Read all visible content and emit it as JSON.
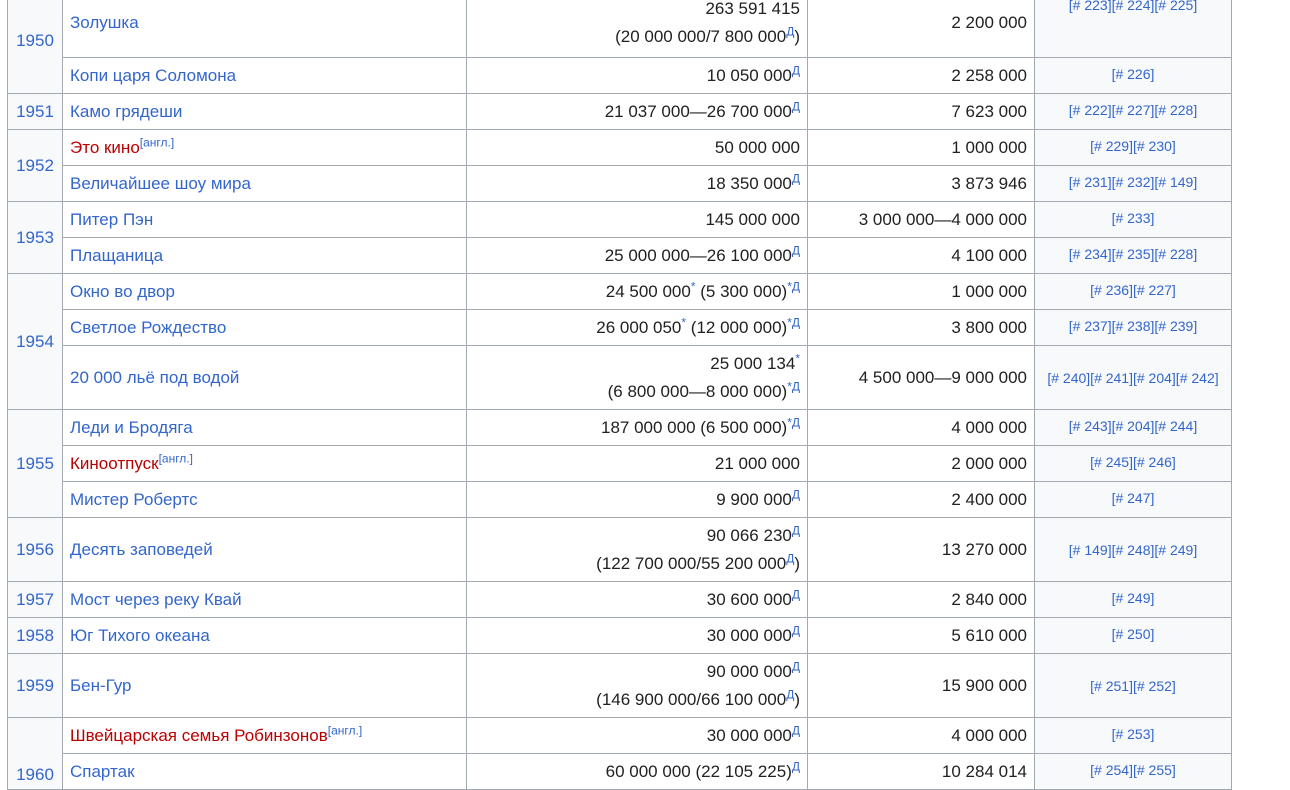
{
  "rows": [
    {
      "year": "1950",
      "title": "Золушка",
      "gross1": "263 591 415",
      "gross2": "(20 000 000/7 800 000",
      "gross2_sup": "Д",
      "gross2_tail": ")",
      "budget": "2 200 000",
      "refs": "[# 223][# 224][# 225]"
    },
    {
      "title": "Копи царя Соломона",
      "gross1": "10 050 000",
      "gross1_sup": "Д",
      "budget": "2 258 000",
      "refs": "[# 226]"
    },
    {
      "year": "1951",
      "title": "Камо грядеши",
      "gross1": "21 037 000—26 700 000",
      "gross1_sup": "Д",
      "budget": "7 623 000",
      "refs": "[# 222][# 227][# 228]"
    },
    {
      "year": "1952",
      "title": "Это кино",
      "title_sup": "[англ.]",
      "gross1": "50 000 000",
      "budget": "1 000 000",
      "refs": "[# 229][# 230]"
    },
    {
      "title": "Величайшее шоу мира",
      "gross1": "18 350 000",
      "gross1_sup": "Д",
      "budget": "3 873 946",
      "refs": "[# 231][# 232][# 149]"
    },
    {
      "year": "1953",
      "title": "Питер Пэн",
      "gross1": "145 000 000",
      "budget": "3 000 000—4 000 000",
      "refs": "[# 233]"
    },
    {
      "title": "Плащаница",
      "gross1": "25 000 000—26 100 000",
      "gross1_sup": "Д",
      "budget": "4 100 000",
      "refs": "[# 234][# 235][# 228]"
    },
    {
      "year": "1954",
      "title": "Окно во двор",
      "gross1": "24 500 000",
      "gross1_star": "*",
      "gross1_b": " (5 300 000)",
      "gross1_sup": "*Д",
      "budget": "1 000 000",
      "refs": "[# 236][# 227]"
    },
    {
      "title": "Светлое Рождество",
      "gross1": "26 000 050",
      "gross1_star": "*",
      "gross1_b": " (12 000 000)",
      "gross1_sup": "*Д",
      "budget": "3 800 000",
      "refs": "[# 237][# 238][# 239]"
    },
    {
      "title": "20 000 льё под водой",
      "gross1": "25 000 134",
      "gross1_star": "*",
      "gross2": "(6 800 000—8 000 000)",
      "gross2_sup": "*Д",
      "budget": "4 500 000—9 000 000",
      "refs": "[# 240][# 241][# 204][# 242]"
    },
    {
      "year": "1955",
      "title": "Леди и Бродяга",
      "gross1": "187 000 000 (6 500 000)",
      "gross1_sup": "*Д",
      "budget": "4 000 000",
      "refs": "[# 243][# 204][# 244]"
    },
    {
      "title": "Киноотпуск",
      "title_sup": "[англ.]",
      "gross1": "21 000 000",
      "budget": "2 000 000",
      "refs": "[# 245][# 246]"
    },
    {
      "title": "Мистер Робертс",
      "gross1": "9 900 000",
      "gross1_sup": "Д",
      "budget": "2 400 000",
      "refs": "[# 247]"
    },
    {
      "year": "1956",
      "title": "Десять заповедей",
      "gross1": "90 066 230",
      "gross1_sup": "Д",
      "gross2": "(122 700 000/55 200 000",
      "gross2_sup": "Д",
      "gross2_tail": ")",
      "budget": "13 270 000",
      "refs": "[# 149][# 248][# 249]"
    },
    {
      "year": "1957",
      "title": "Мост через реку Квай",
      "gross1": "30 600 000",
      "gross1_sup": "Д",
      "budget": "2 840 000",
      "refs": "[# 249]"
    },
    {
      "year": "1958",
      "title": "Юг Тихого океана",
      "gross1": "30 000 000",
      "gross1_sup": "Д",
      "budget": "5 610 000",
      "refs": "[# 250]"
    },
    {
      "year": "1959",
      "title": "Бен-Гур",
      "gross1": "90 000 000",
      "gross1_sup": "Д",
      "gross2": "(146 900 000/66 100 000",
      "gross2_sup": "Д",
      "gross2_tail": ")",
      "budget": "15 900 000",
      "refs": "[# 251][# 252]"
    },
    {
      "year": "1960",
      "title": "Швейцарская семья Робинзонов",
      "title_sup": "[англ.]",
      "gross1": "30 000 000",
      "gross1_sup": "Д",
      "budget": "4 000 000",
      "refs": "[# 253]"
    },
    {
      "title": "Спартак",
      "gross1": "60 000 000 (22 105 225)",
      "gross1_sup": "Д",
      "budget": "10 284 014",
      "refs": "[# 254][# 255]"
    }
  ]
}
